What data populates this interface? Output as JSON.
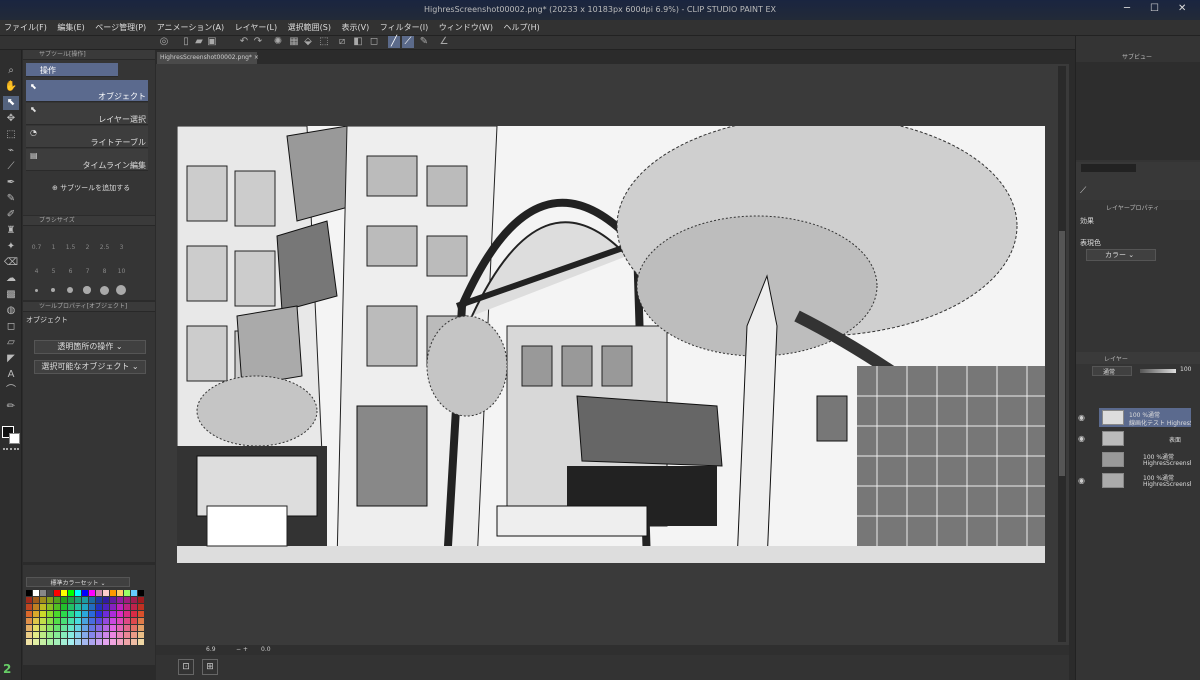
{
  "window": {
    "title": "HighresScreenshot00002.png* (20233 x 10183px 600dpi 6.9%) - CLIP STUDIO PAINT EX"
  },
  "menu": [
    "ファイル(F)",
    "編集(E)",
    "ページ管理(P)",
    "アニメーション(A)",
    "レイヤー(L)",
    "選択範囲(S)",
    "表示(V)",
    "フィルター(I)",
    "ウィンドウ(W)",
    "ヘルプ(H)"
  ],
  "subtool_panel": {
    "header": "サブツール[操作]",
    "group_label": "操作",
    "items": [
      "オブジェクト",
      "レイヤー選択",
      "ライトテーブル",
      "タイムライン編集"
    ],
    "add_label": "サブツールを追加する"
  },
  "brush_size": {
    "header": "ブラシサイズ",
    "sizes": [
      "0.7",
      "1",
      "1.5",
      "2",
      "2.5",
      "3",
      "4",
      "5",
      "6",
      "7",
      "8",
      "10"
    ]
  },
  "tool_property": {
    "header": "ツールプロパティ[オブジェクト]",
    "title": "オブジェクト",
    "dropdown1": "透明箇所の操作",
    "dropdown2": "選択可能なオブジェクト"
  },
  "color_set": {
    "label": "標準カラーセット"
  },
  "document_tab": "HighresScreenshot00002.png*",
  "status": {
    "zoom": "6.9",
    "angle": "0.0"
  },
  "right": {
    "subview_label": "サブビュー",
    "layer_prop_label": "レイヤープロパティ",
    "effect_label": "効果",
    "expression_label": "表現色",
    "expression_value": "カラー",
    "layer_header": "レイヤー",
    "blend_mode": "通常",
    "opacity": "100",
    "layers": [
      {
        "line1": "100 %通常",
        "line2": "線画化テスト HighresScr"
      },
      {
        "line1": "",
        "line2": "表面"
      },
      {
        "line1": "100 %通常",
        "line2": "HighresScreensh"
      },
      {
        "line1": "100 %通常",
        "line2": "HighresScreensh"
      }
    ]
  },
  "bottom_left_number": "2"
}
